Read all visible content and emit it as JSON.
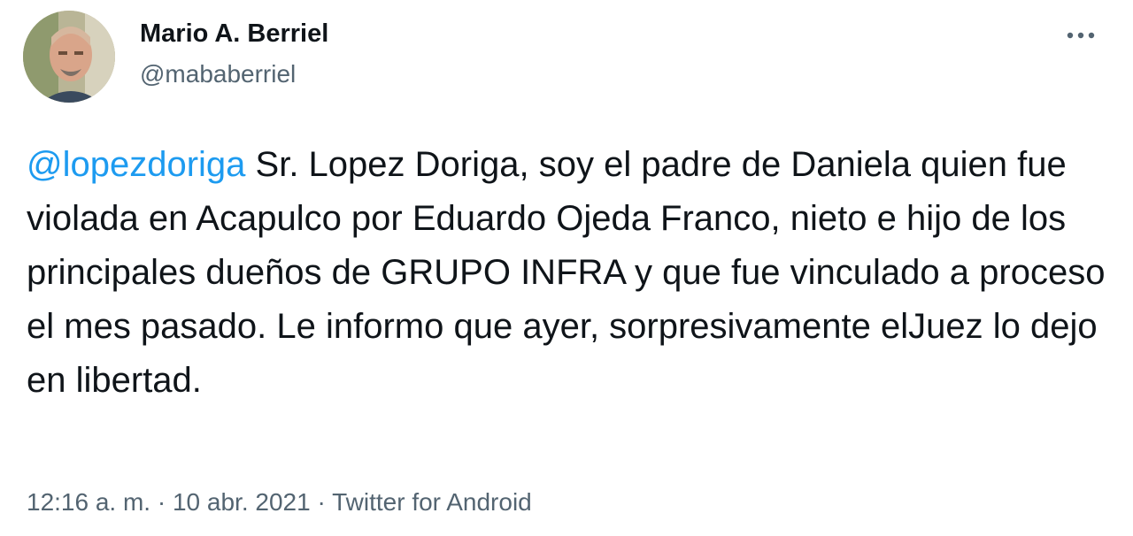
{
  "author": {
    "display_name": "Mario A. Berriel",
    "handle": "@mababerriel"
  },
  "more_icon": "more-horizontal-icon",
  "tweet": {
    "mention": "@lopezdoriga",
    "body": " Sr. Lopez Doriga, soy el padre de Daniela quien fue violada en Acapulco por Eduardo Ojeda Franco, nieto e hijo de los principales dueños de GRUPO INFRA y que fue vinculado a proceso el mes pasado. Le informo que ayer, sorpresivamente elJuez lo dejo en libertad."
  },
  "meta": {
    "time": "12:16 a. m.",
    "separator": " · ",
    "date": "10 abr. 2021",
    "source": "Twitter for Android"
  },
  "colors": {
    "accent": "#1d9bf0",
    "secondary_text": "#536471",
    "primary_text": "#0f1419"
  }
}
